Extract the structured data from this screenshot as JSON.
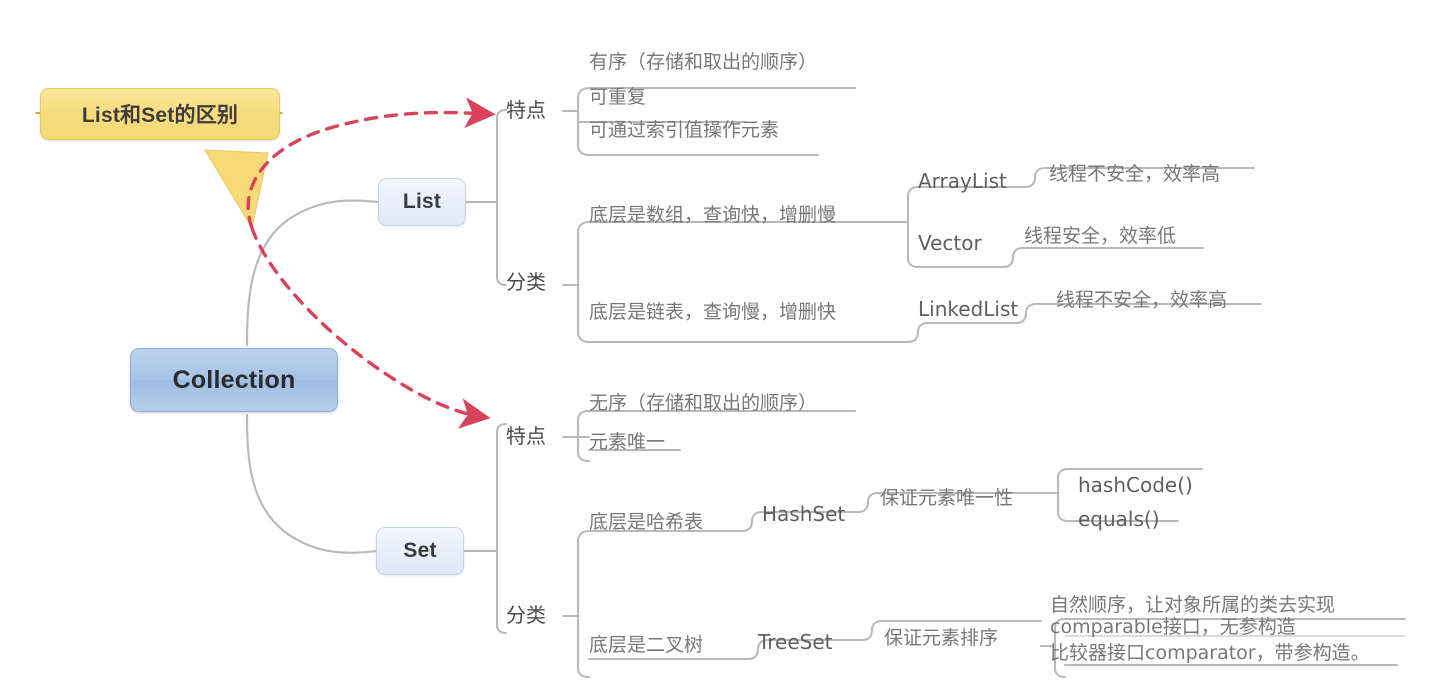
{
  "diagram": {
    "title": "Collection mind map",
    "root": {
      "label": "Collection"
    },
    "callout": {
      "label": "List和Set的区别"
    },
    "colors": {
      "root_fill": "#a6c4e6",
      "branch_fill": "#e6eefa",
      "callout_fill": "#f7dc7d",
      "edge": "#b9b9b9",
      "annotation_arrow": "#d9425c",
      "text": "#787878"
    },
    "branches": [
      {
        "id": "list",
        "label": "List",
        "groups": [
          {
            "label": "特点",
            "items": [
              {
                "label": "有序（存储和取出的顺序）"
              },
              {
                "label": "可重复"
              },
              {
                "label": "可通过索引值操作元素"
              }
            ]
          },
          {
            "label": "分类",
            "items": [
              {
                "label": "底层是数组，查询快，增删慢",
                "children": [
                  {
                    "label": "ArrayList",
                    "note": "线程不安全，效率高"
                  },
                  {
                    "label": "Vector",
                    "note": "线程安全，效率低"
                  }
                ]
              },
              {
                "label": "底层是链表，查询慢，增删快",
                "children": [
                  {
                    "label": "LinkedList",
                    "note": "线程不安全，效率高"
                  }
                ]
              }
            ]
          }
        ]
      },
      {
        "id": "set",
        "label": "Set",
        "groups": [
          {
            "label": "特点",
            "items": [
              {
                "label": "无序（存储和取出的顺序）"
              },
              {
                "label": "元素唯一"
              }
            ]
          },
          {
            "label": "分类",
            "items": [
              {
                "label": "底层是哈希表",
                "children": [
                  {
                    "label": "HashSet",
                    "note": "保证元素唯一性",
                    "leaves": [
                      {
                        "label": "hashCode()"
                      },
                      {
                        "label": "equals()"
                      }
                    ]
                  }
                ]
              },
              {
                "label": "底层是二叉树",
                "children": [
                  {
                    "label": "TreeSet",
                    "note": "保证元素排序",
                    "leaves": [
                      {
                        "label": "自然顺序，让对象所属的类去实现comparable接口，无参构造"
                      },
                      {
                        "label": "比较器接口comparator，带参构造。"
                      }
                    ]
                  }
                ]
              }
            ]
          }
        ]
      }
    ],
    "annotations": [
      {
        "from": "callout",
        "to": "list-特点"
      },
      {
        "from": "callout",
        "to": "set-特点"
      }
    ]
  }
}
